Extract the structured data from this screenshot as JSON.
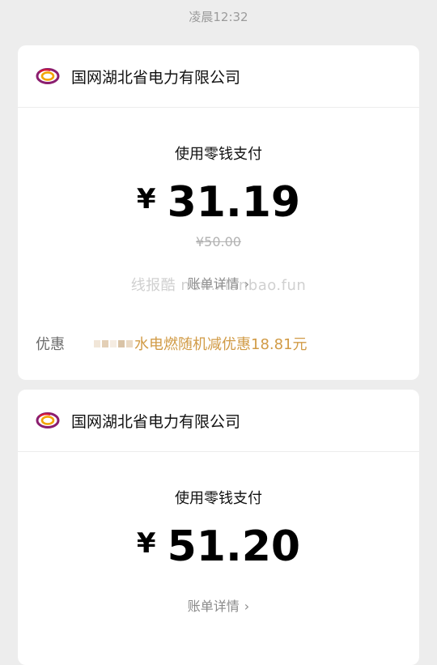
{
  "status_time": "凌晨12:32",
  "watermark": "线报酷 new.xianbao.fun",
  "transactions": [
    {
      "merchant": "国网湖北省电力有限公司",
      "pay_method": "使用零钱支付",
      "currency": "¥",
      "amount": "31.19",
      "original_amount": "¥50.00",
      "details_label": "账单详情",
      "discount_label": "优惠",
      "discount_text": "水电燃随机减优惠18.81元"
    },
    {
      "merchant": "国网湖北省电力有限公司",
      "pay_method": "使用零钱支付",
      "currency": "¥",
      "amount": "51.20",
      "details_label": "账单详情"
    }
  ],
  "colors": {
    "accent": "#d19b46",
    "background": "#ededed",
    "card": "#ffffff"
  },
  "icons": {
    "logo": "state-grid-logo-icon",
    "chevron": "chevron-right-icon"
  }
}
